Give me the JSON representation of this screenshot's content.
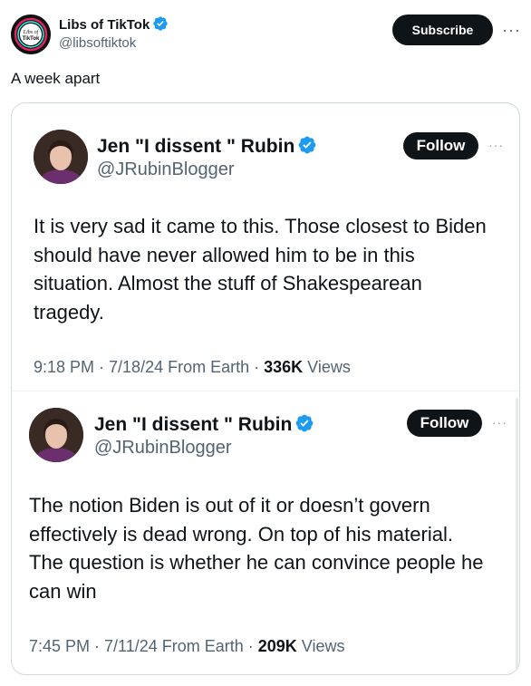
{
  "post": {
    "author_name": "Libs of TikTok",
    "author_handle": "@libsoftiktok",
    "subscribe_label": "Subscribe",
    "more_label": "···",
    "text": "A week apart"
  },
  "screenshots": [
    {
      "name": "Jen \"I dissent \" Rubin",
      "handle": "@JRubinBlogger",
      "follow_label": "Follow",
      "more_label": "···",
      "text_lines": [
        "It is very sad it came to this. Those closest to Biden",
        "should have never allowed him to be in this",
        "situation. Almost the stuff of Shakespearean",
        "tragedy."
      ],
      "time": "9:18 PM · 7/18/24 From Earth · ",
      "views_count": "336K",
      "views_label": " Views"
    },
    {
      "name": "Jen \"I dissent \" Rubin",
      "handle": "@JRubinBlogger",
      "follow_label": "Follow",
      "more_label": "···",
      "text_lines": [
        "The notion Biden is out of it or doesn’t govern",
        "effectively is dead wrong. On top of his material.",
        "The question is whether he can convince people he",
        "can win"
      ],
      "time": "7:45 PM · 7/11/24 From Earth · ",
      "views_count": "209K",
      "views_label": " Views"
    }
  ],
  "colors": {
    "verified": "#1d9bf0",
    "button": "#0f1419",
    "secondary_text": "#536471"
  },
  "avatar_logo": "Libs of TikTok"
}
